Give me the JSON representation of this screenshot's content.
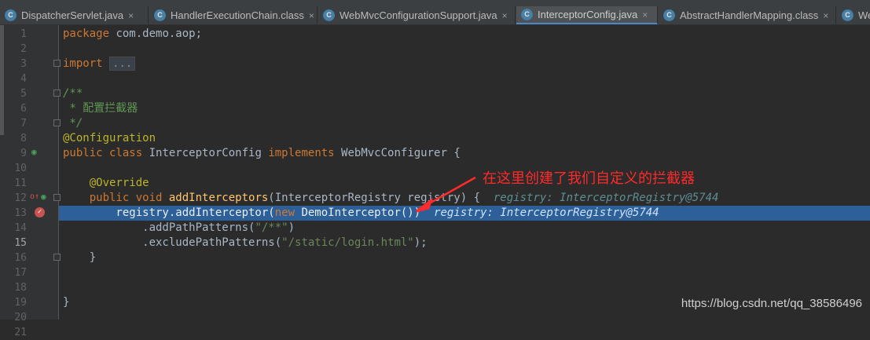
{
  "tabs": [
    {
      "label": "DispatcherServlet.java",
      "icon": "class-icon",
      "close": "×"
    },
    {
      "label": "HandlerExecutionChain.class",
      "icon": "class-icon",
      "close": "×"
    },
    {
      "label": "WebMvcConfigurationSupport.java",
      "icon": "class-icon",
      "close": "×"
    },
    {
      "label": "InterceptorConfig.java",
      "icon": "class-icon",
      "close": "×"
    },
    {
      "label": "AbstractHandlerMapping.class",
      "icon": "class-icon",
      "close": "×"
    },
    {
      "label": "We",
      "icon": "class-icon",
      "close": ""
    }
  ],
  "active_tab": "InterceptorConfig.java",
  "line_numbers": [
    "1",
    "2",
    "3",
    "4",
    "5",
    "6",
    "7",
    "8",
    "9",
    "10",
    "11",
    "12",
    "13",
    "14",
    "15",
    "16",
    "17",
    "18",
    "19",
    "20",
    "21"
  ],
  "highlighted_line": "15",
  "code": {
    "l1_kw": "package",
    "l1_rest": " com.demo.aop;",
    "l3_kw": "import",
    "l3_fold": "...",
    "l7": "/**",
    "l8_star": " * ",
    "l8_cn": "配置拦截器",
    "l9": " */",
    "l10": "@Configuration",
    "l11_kw1": "public class",
    "l11_name": " InterceptorConfig ",
    "l11_kw2": "implements",
    "l11_rest": " WebMvcConfigurer {",
    "l13": "    @Override",
    "l14_kw": "    public void",
    "l14_fn": " addInterceptors",
    "l14_rest": "(InterceptorRegistry registry) {",
    "l14_hint": "registry: InterceptorRegistry@5744",
    "l15_a": "        registry.addInterceptor(",
    "l15_kw": "new",
    "l15_b": " DemoInterceptor())",
    "l15_hint": "registry: InterceptorRegistry@5744",
    "l16_a": "            .addPathPatterns(",
    "l16_str": "\"/**\"",
    "l16_b": ")",
    "l17_a": "            .excludePathPatterns(",
    "l17_str": "\"/static/login.html\"",
    "l17_b": ");",
    "l18": "    }",
    "l21": "}"
  },
  "annotation_note": "在这里创建了我们自定义的拦截器",
  "watermark": "https://blog.csdn.net/qq_38586496",
  "colors": {
    "accent": "#2d6099",
    "arrow": "#ff2a2a",
    "note": "#ff2a2a"
  }
}
